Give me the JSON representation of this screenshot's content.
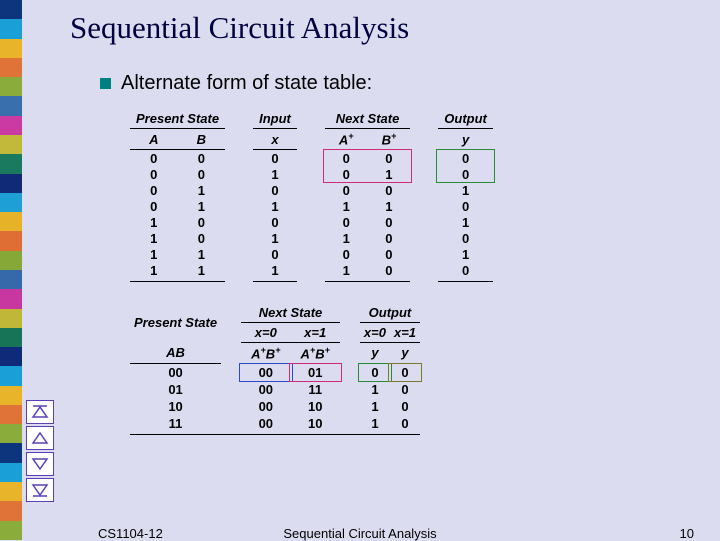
{
  "title": "Sequential Circuit Analysis",
  "bullet": "Alternate form of state table:",
  "table1": {
    "group_headers": [
      "Present State",
      "Input",
      "Next State",
      "Output"
    ],
    "col_headers": [
      "A",
      "B",
      "x",
      "A⁺",
      "B⁺",
      "y"
    ],
    "rows": [
      [
        "0",
        "0",
        "0",
        "0",
        "0",
        "0"
      ],
      [
        "0",
        "0",
        "1",
        "0",
        "1",
        "0"
      ],
      [
        "0",
        "1",
        "0",
        "0",
        "0",
        "1"
      ],
      [
        "0",
        "1",
        "1",
        "1",
        "1",
        "0"
      ],
      [
        "1",
        "0",
        "0",
        "0",
        "0",
        "1"
      ],
      [
        "1",
        "0",
        "1",
        "1",
        "0",
        "0"
      ],
      [
        "1",
        "1",
        "0",
        "0",
        "0",
        "1"
      ],
      [
        "1",
        "1",
        "1",
        "1",
        "0",
        "0"
      ]
    ]
  },
  "table2": {
    "group_headers": [
      "Present State",
      "Next State",
      "Output"
    ],
    "sub_headers_ns": [
      "x=0",
      "x=1"
    ],
    "sub_headers_out": [
      "x=0",
      "x=1"
    ],
    "col_headers": [
      "AB",
      "A⁺B⁺",
      "A⁺B⁺",
      "y",
      "y"
    ],
    "rows": [
      [
        "00",
        "00",
        "01",
        "0",
        "0"
      ],
      [
        "01",
        "00",
        "11",
        "1",
        "0"
      ],
      [
        "10",
        "00",
        "10",
        "1",
        "0"
      ],
      [
        "11",
        "00",
        "10",
        "1",
        "0"
      ]
    ]
  },
  "footer": {
    "left": "CS1104-12",
    "center": "Sequential Circuit Analysis",
    "right": "10"
  },
  "sidebar_colors": [
    "#0d357d",
    "#1a9fd6",
    "#e7b42a",
    "#e07338",
    "#8aac3a",
    "#3a6fae",
    "#ca3aa2",
    "#c2b93a",
    "#1a7a5f",
    "#112a78",
    "#1ea0d6",
    "#e6b228",
    "#de6e33",
    "#86a836",
    "#3669a9",
    "#c837a0",
    "#c0b739",
    "#187456",
    "#0f2a78",
    "#1a9fd6",
    "#e7b42a",
    "#e07338",
    "#8aac3a",
    "#0d357d",
    "#1a9fd6",
    "#e7b42a",
    "#e07338",
    "#8aac3a"
  ]
}
